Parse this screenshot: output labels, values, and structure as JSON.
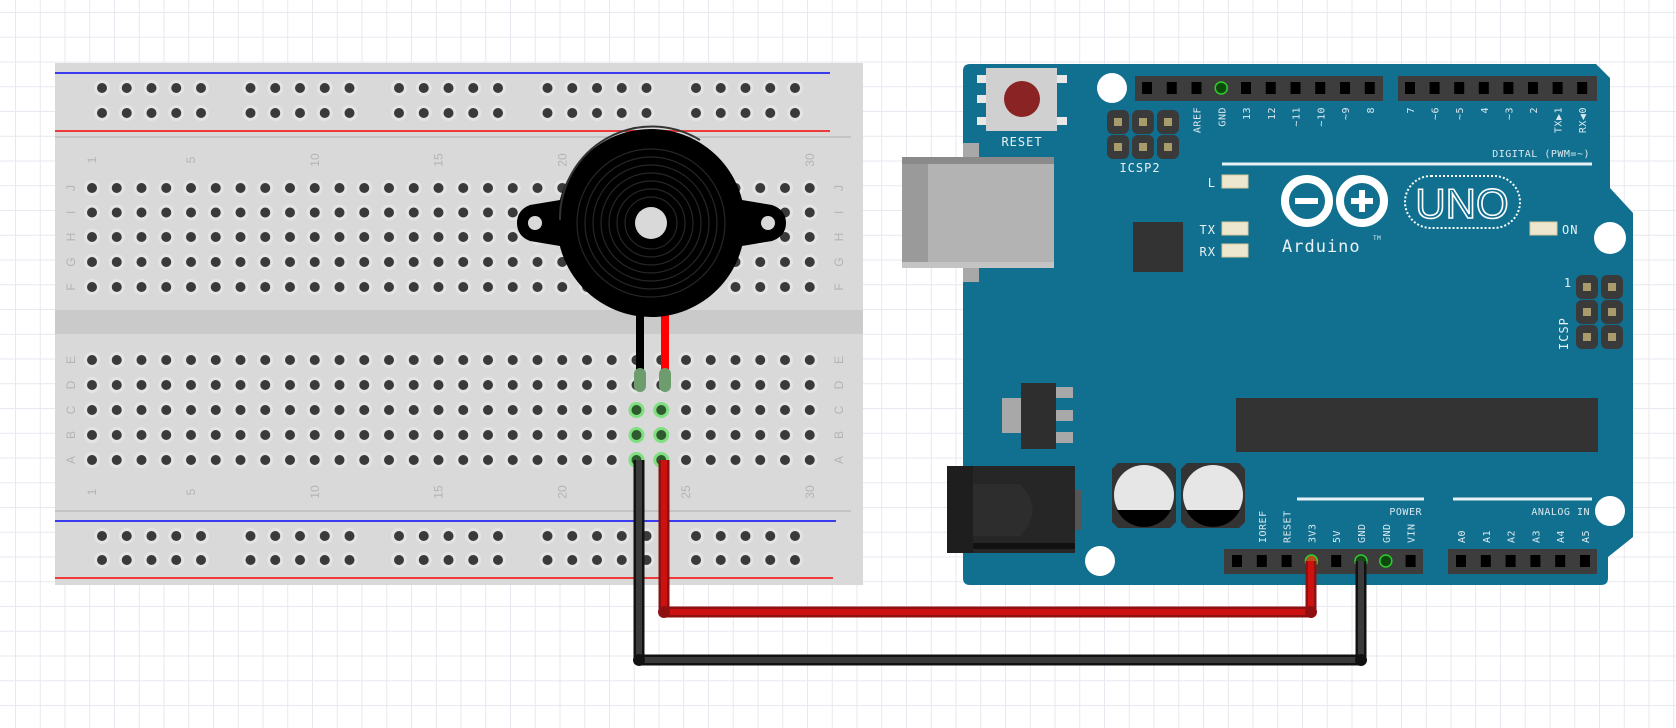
{
  "breadboard": {
    "column_labels": [
      "1",
      "5",
      "10",
      "15",
      "20",
      "25",
      "30"
    ],
    "column_label_numbers": [
      1,
      5,
      10,
      15,
      20,
      25,
      30
    ],
    "top_rows": [
      "J",
      "I",
      "H",
      "G",
      "F"
    ],
    "bottom_rows": [
      "E",
      "D",
      "C",
      "B",
      "A"
    ],
    "columns": 30,
    "connected_columns": [
      23,
      24
    ],
    "rail_colors": {
      "negative": "#3a3aee",
      "positive": "#ee3a3a"
    }
  },
  "buzzer": {
    "pin_colors": [
      "#000000",
      "#ff0000"
    ]
  },
  "arduino": {
    "reset_label": "RESET",
    "icsp2_label": "ICSP2",
    "icsp_label": "ICSP",
    "icsp_pin1": "1",
    "digital_label": "DIGITAL (PWM=~)",
    "led_l": "L",
    "led_tx": "TX",
    "led_rx": "RX",
    "led_on": "ON",
    "brand": "Arduino",
    "trademark": "TM",
    "model": "UNO",
    "power_label": "POWER",
    "analog_label": "ANALOG IN",
    "digital_pins_high": [
      "AREF",
      "GND",
      "13",
      "12",
      "~11",
      "~10",
      "~9",
      "8"
    ],
    "digital_pins_low": [
      "7",
      "~6",
      "~5",
      "4",
      "~3",
      "2",
      "TX▶1",
      "RX◀0"
    ],
    "power_pins": [
      "",
      "IOREF",
      "RESET",
      "3V3",
      "5V",
      "GND",
      "GND",
      "VIN"
    ],
    "analog_pins": [
      "A0",
      "A1",
      "A2",
      "A3",
      "A4",
      "A5"
    ],
    "board_color": "#11708f"
  },
  "wires": [
    {
      "color": "#cc1111",
      "from": "breadboard column 24",
      "to": "3V3"
    },
    {
      "color": "#222222",
      "from": "breadboard column 23",
      "to": "GND"
    }
  ]
}
